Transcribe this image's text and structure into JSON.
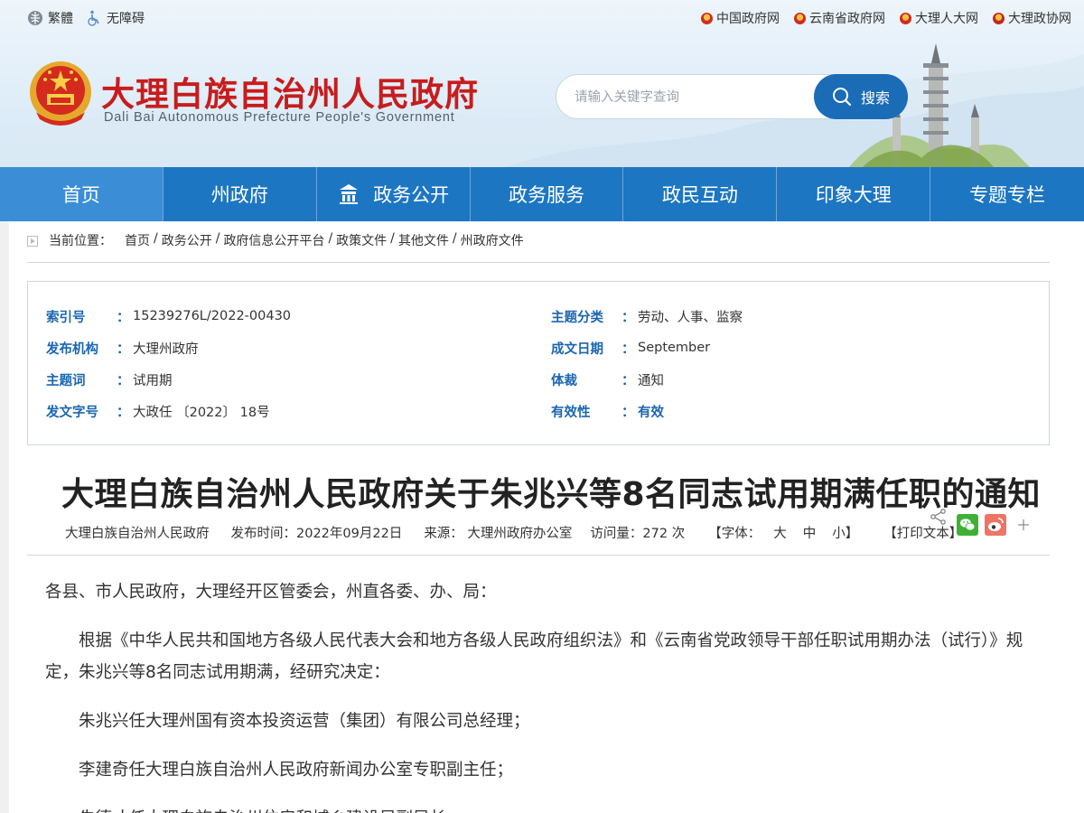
{
  "topbar": {
    "traditional": "繁體",
    "accessibility": "无障碍",
    "links": [
      "中国政府网",
      "云南省政府网",
      "大理人大网",
      "大理政协网"
    ]
  },
  "site": {
    "title": "大理白族自治州人民政府",
    "subtitle": "Dali Bai Autonomous Prefecture People's Government"
  },
  "search": {
    "placeholder": "请输入关键字查询",
    "button": "搜索"
  },
  "nav": [
    "首页",
    "州政府",
    "政务公开",
    "政务服务",
    "政民互动",
    "印象大理",
    "专题专栏"
  ],
  "breadcrumb": {
    "label": "当前位置：",
    "items": [
      "首页",
      "政务公开",
      "政府信息公开平台",
      "政策文件",
      "其他文件",
      "州政府文件"
    ],
    "separator": "/"
  },
  "info": {
    "index_label": "索引号",
    "index_value": "15239276L/2022-00430",
    "topic_class_label": "主题分类",
    "topic_class_value": "劳动、人事、监察",
    "publisher_label": "发布机构",
    "publisher_value": "大理州政府",
    "date_label": "成文日期",
    "date_value": "September",
    "keyword_label": "主题词",
    "keyword_value": "试用期",
    "genre_label": "体裁",
    "genre_value": "通知",
    "docno_label": "发文字号",
    "docno_value": "大政任 〔2022〕 18号",
    "validity_label": "有效性",
    "validity_value": "有效",
    "colon": "："
  },
  "doc": {
    "title": "大理白族自治州人民政府关于朱兆兴等8名同志试用期满任职的通知",
    "issuer": "大理白族自治州人民政府",
    "publish_time": "发布时间：2022年09月22日",
    "source": "来源：  大理州政府办公室",
    "visits": "访问量：272 次",
    "font_label": "【字体：",
    "font_large": "大",
    "font_medium": "中",
    "font_small": "小】",
    "print": "【打印文本】",
    "paragraphs": [
      "各县、市人民政府，大理经开区管委会，州直各委、办、局：",
      "根据《中华人民共和国地方各级人民代表大会和地方各级人民政府组织法》和《云南省党政领导干部任职试用期办法（试行）》规定，朱兆兴等8名同志试用期满，经研究决定：",
      "朱兆兴任大理州国有资本投资运营（集团）有限公司总经理；",
      "李建奇任大理白族自治州人民政府新闻办公室专职副主任；",
      "朱德才任大理白族自治州住房和城乡建设局副局长；"
    ]
  },
  "colors": {
    "brand_red": "#c81c1c",
    "nav_blue": "#1d76c2",
    "label_blue": "#1b66b1",
    "wechat_green": "#3eb135",
    "weibo_red": "#e6162d"
  }
}
